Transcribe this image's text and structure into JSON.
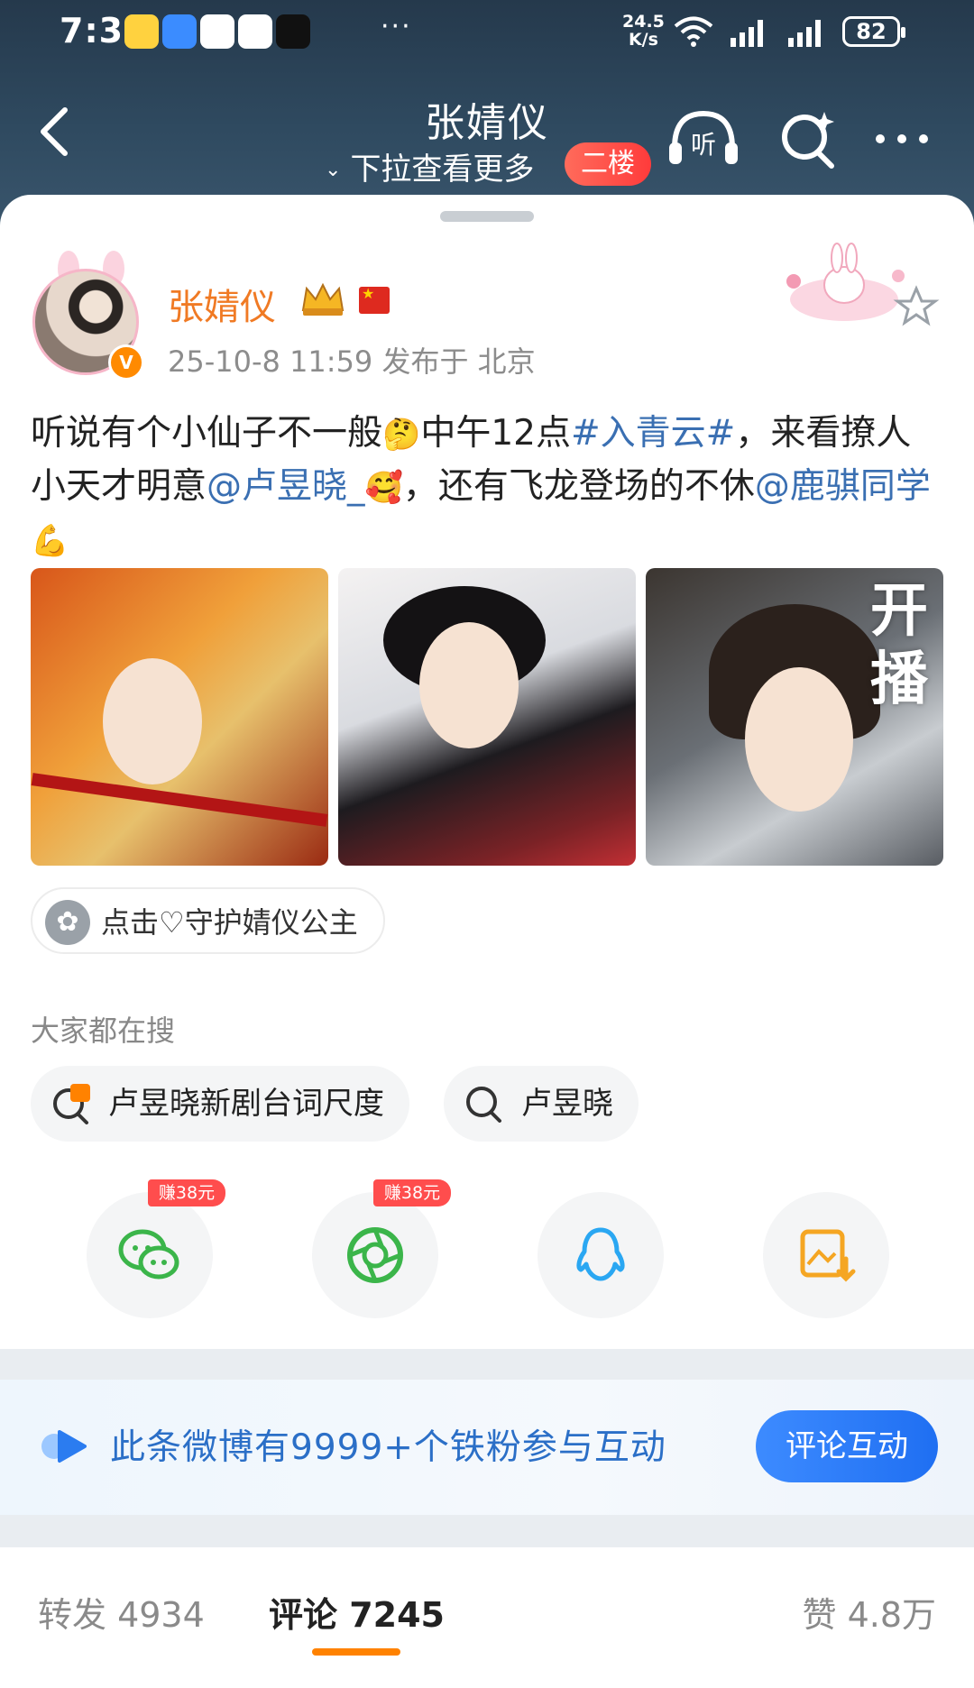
{
  "status_bar": {
    "time": "7:34",
    "more": "···",
    "net_speed": "24.5",
    "net_unit": "K/s",
    "battery": "82",
    "app_icons": [
      "notification-coin-icon",
      "wifi-app-icon",
      "mobile-app-icon",
      "qq-icon",
      "tiktok-icon"
    ]
  },
  "header": {
    "title": "张婧仪",
    "subtitle": "下拉查看更多",
    "floor_badge": "二楼",
    "listen_label": "听",
    "icons": [
      "back-icon",
      "listen-icon",
      "search-icon",
      "more-icon"
    ]
  },
  "post": {
    "author": "张婧仪",
    "meta": "25-10-8 11:59  发布于 北京",
    "text_segments": [
      {
        "t": "听说有个小仙子不一般",
        "type": "text"
      },
      {
        "t": "🤔",
        "type": "emoji"
      },
      {
        "t": "中午12点",
        "type": "text"
      },
      {
        "t": "#入青云#",
        "type": "link"
      },
      {
        "t": "，来看撩人小天才明意",
        "type": "text"
      },
      {
        "t": "@卢昱晓_",
        "type": "link"
      },
      {
        "t": "🥰",
        "type": "emoji"
      },
      {
        "t": "，还有飞龙登场的不休",
        "type": "text"
      },
      {
        "t": "@鹿骐同学",
        "type": "link"
      },
      {
        "t": "💪",
        "type": "emoji"
      }
    ],
    "photo3_caption_1": "开",
    "photo3_caption_2": "播",
    "chip_label": "点击♡守护婧仪公主"
  },
  "search": {
    "title": "大家都在搜",
    "items": [
      {
        "label": "卢昱晓新剧台词尺度",
        "icon": "hot-search-icon"
      },
      {
        "label": "卢昱晓",
        "icon": "search-icon"
      }
    ]
  },
  "share": {
    "reward_label": "赚38元",
    "targets": [
      "wechat-icon",
      "moments-icon",
      "qq-icon",
      "save-image-icon"
    ]
  },
  "banner": {
    "text": "此条微博有9999+个铁粉参与互动",
    "button": "评论互动"
  },
  "tabs": {
    "repost": "转发 4934",
    "comments": "评论 7245",
    "likes": "赞 4.8万",
    "active": "comments"
  },
  "colors": {
    "header_bg": "#2f4a60",
    "username": "#f07a24",
    "link": "#3a6fb2",
    "accent_orange": "#ff8200",
    "banner_button": "#1f6ff2",
    "reward_red": "#ff4d4d"
  }
}
